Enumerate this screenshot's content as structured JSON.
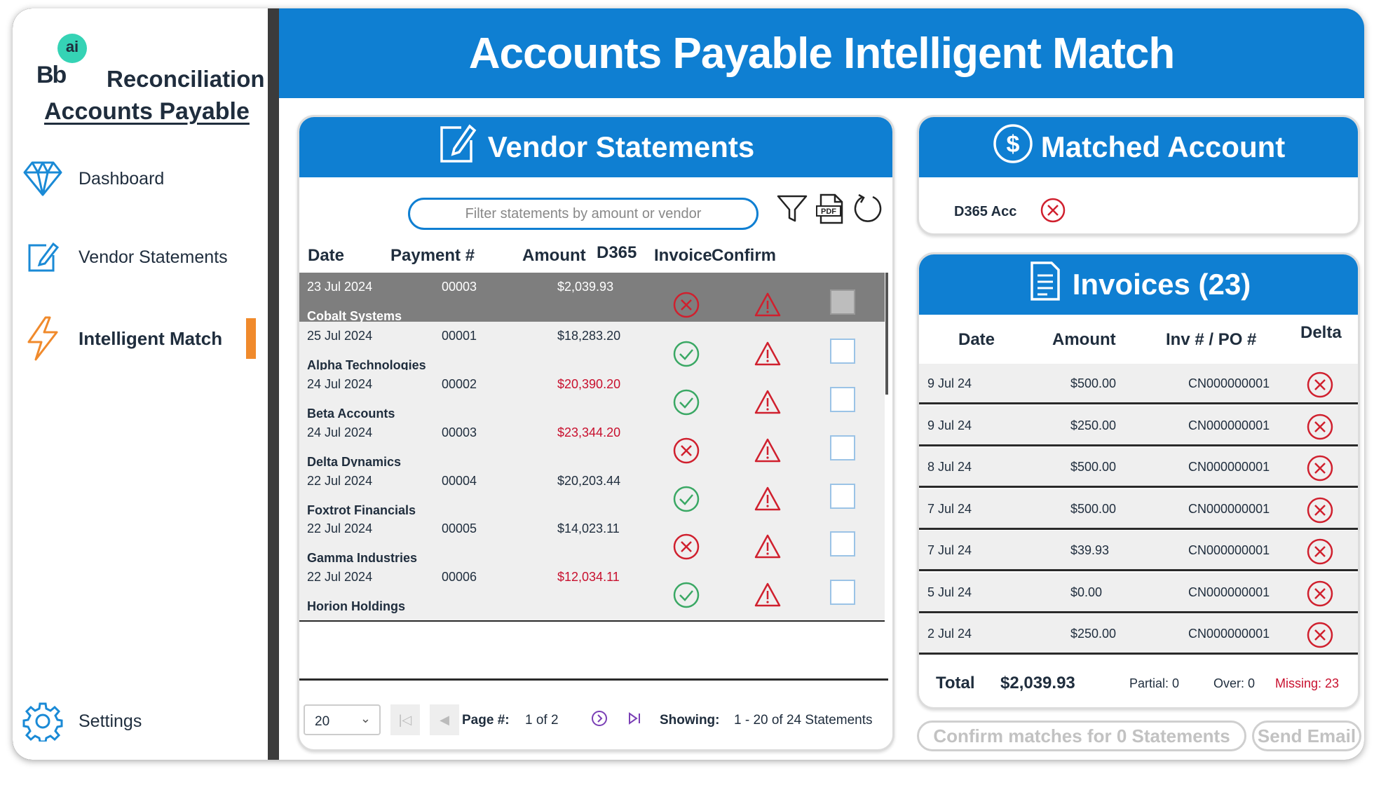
{
  "sidebar": {
    "logo_bb": "Bb",
    "logo_ai": "ai",
    "logo_text": "Reconciliation",
    "section_title": "Accounts Payable",
    "items": [
      {
        "label": "Dashboard",
        "icon": "diamond-icon"
      },
      {
        "label": "Vendor Statements",
        "icon": "edit-document-icon"
      },
      {
        "label": "Intelligent Match",
        "icon": "lightning-icon"
      }
    ],
    "settings_label": "Settings"
  },
  "header": {
    "title": "Accounts Payable Intelligent Match"
  },
  "vendor_statements": {
    "title": "Vendor Statements",
    "filter_placeholder": "Filter statements by amount or vendor",
    "columns": [
      "Date",
      "Payment #",
      "Amount",
      "D365",
      "Invoice",
      "Confirm"
    ],
    "rows": [
      {
        "date": "23 Jul 2024",
        "payment": "00003",
        "amount": "$2,039.93",
        "amount_red": false,
        "vendor": "Cobalt Systems",
        "d365": "x",
        "selected": true
      },
      {
        "date": "25 Jul 2024",
        "payment": "00001",
        "amount": "$18,283.20",
        "amount_red": false,
        "vendor": "Alpha Technologies",
        "d365": "check",
        "selected": false
      },
      {
        "date": "24 Jul 2024",
        "payment": "00002",
        "amount": "$20,390.20",
        "amount_red": true,
        "vendor": "Beta Accounts",
        "d365": "check",
        "selected": false
      },
      {
        "date": "24 Jul 2024",
        "payment": "00003",
        "amount": "$23,344.20",
        "amount_red": true,
        "vendor": "Delta Dynamics",
        "d365": "x",
        "selected": false
      },
      {
        "date": "22 Jul 2024",
        "payment": "00004",
        "amount": "$20,203.44",
        "amount_red": false,
        "vendor": "Foxtrot Financials",
        "d365": "check",
        "selected": false
      },
      {
        "date": "22 Jul 2024",
        "payment": "00005",
        "amount": "$14,023.11",
        "amount_red": false,
        "vendor": "Gamma Industries",
        "d365": "x",
        "selected": false
      },
      {
        "date": "22 Jul 2024",
        "payment": "00006",
        "amount": "$12,034.11",
        "amount_red": true,
        "vendor": "Horion Holdings",
        "d365": "check",
        "selected": false
      }
    ],
    "pager": {
      "page_size": "20",
      "page_label": "Page #:",
      "page_value": "1 of 2",
      "showing_label": "Showing:",
      "showing_value": "1 - 20 of 24 Statements"
    }
  },
  "matched_account": {
    "title": "Matched Account",
    "account_label": "D365 Acc"
  },
  "invoices": {
    "title": "Invoices (23)",
    "columns": [
      "Date",
      "Amount",
      "Inv # / PO #",
      "Delta"
    ],
    "rows": [
      {
        "date": "9 Jul 24",
        "amount": "$500.00",
        "inv": "CN000000001"
      },
      {
        "date": "9 Jul 24",
        "amount": "$250.00",
        "inv": "CN000000001"
      },
      {
        "date": "8 Jul 24",
        "amount": "$500.00",
        "inv": "CN000000001"
      },
      {
        "date": "7 Jul 24",
        "amount": "$500.00",
        "inv": "CN000000001"
      },
      {
        "date": "7 Jul 24",
        "amount": "$39.93",
        "inv": "CN000000001"
      },
      {
        "date": "5 Jul 24",
        "amount": "$0.00",
        "inv": "CN000000001"
      },
      {
        "date": "2 Jul 24",
        "amount": "$250.00",
        "inv": "CN000000001"
      }
    ],
    "total_label": "Total",
    "total_value": "$2,039.93",
    "partial": "Partial: 0",
    "over": "Over: 0",
    "missing": "Missing: 23"
  },
  "actions": {
    "confirm_label": "Confirm matches for 0 Statements",
    "email_label": "Send Email"
  },
  "colors": {
    "brand_blue": "#0f7fd2",
    "accent_orange": "#f08a2c",
    "error_red": "#c8102e",
    "ok_green": "#3aa864"
  }
}
